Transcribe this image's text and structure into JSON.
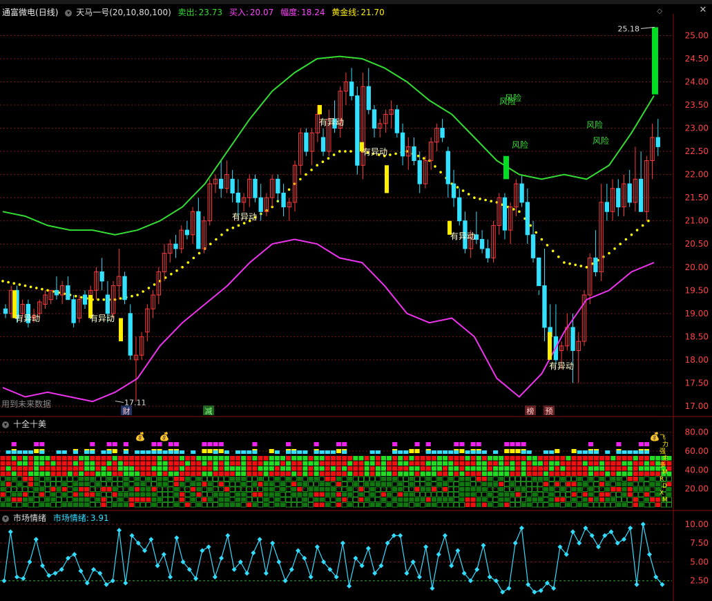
{
  "header": {
    "stock_name": "通富微电",
    "period": "(日线)",
    "indicator_name": "天马一号",
    "indicator_params": "(20,10,80,100)",
    "sell_label": "卖出:",
    "sell_value": "23.73",
    "buy_label": "买入:",
    "buy_value": "20.07",
    "range_label": "幅度:",
    "range_value": "18.24",
    "gold_label": "黄金线:",
    "gold_value": "21.70"
  },
  "panel2": {
    "title": "十全十美"
  },
  "panel3": {
    "title": "市场情绪",
    "label": "市场情绪:",
    "value": "3.91"
  },
  "main_notes": {
    "future_data": "用到未来数据",
    "high_label": "25.18",
    "low_label": "17.11"
  },
  "bottom_tags": [
    {
      "text": "财",
      "x": 183
    },
    {
      "text": "减",
      "x": 302
    },
    {
      "text": "榜",
      "x": 768
    },
    {
      "text": "预",
      "x": 795
    }
  ],
  "annotations": {
    "yidong": "有异动",
    "fengxian": "风险"
  },
  "colors": {
    "up": "#ff3b3b",
    "down": "#33e0ff",
    "upper_band": "#33dd33",
    "lower_band": "#ee33ee",
    "dots": "#ffff00",
    "sell_bar": "#00dd22",
    "buy_bar": "#ffee00",
    "grid": "#7a1a1a"
  },
  "chart_data": [
    {
      "type": "candlestick",
      "title": "天马一号",
      "y_ticks": [
        17.0,
        17.5,
        18.0,
        18.5,
        19.0,
        19.5,
        20.0,
        20.5,
        21.0,
        21.5,
        22.0,
        22.5,
        23.0,
        23.5,
        24.0,
        24.5,
        25.0
      ],
      "ylim": [
        16.85,
        25.35
      ],
      "candles": [
        [
          19.1,
          19.2,
          18.9,
          19.0
        ],
        [
          19.0,
          19.6,
          18.9,
          19.5
        ],
        [
          19.5,
          19.6,
          18.8,
          18.9
        ],
        [
          19.0,
          19.3,
          18.9,
          19.2
        ],
        [
          19.2,
          19.3,
          18.7,
          18.8
        ],
        [
          18.9,
          19.1,
          18.8,
          18.95
        ],
        [
          19.0,
          19.3,
          18.9,
          19.25
        ],
        [
          19.2,
          19.5,
          19.1,
          19.4
        ],
        [
          19.3,
          19.5,
          19.2,
          19.5
        ],
        [
          19.5,
          19.8,
          19.3,
          19.4
        ],
        [
          19.4,
          19.7,
          19.2,
          19.6
        ],
        [
          19.6,
          19.8,
          19.4,
          19.3
        ],
        [
          19.3,
          19.4,
          18.7,
          18.8
        ],
        [
          18.9,
          19.4,
          18.8,
          19.3
        ],
        [
          19.4,
          19.5,
          19.1,
          19.2
        ],
        [
          19.3,
          19.6,
          19.2,
          19.5
        ],
        [
          19.5,
          20.0,
          19.3,
          19.9
        ],
        [
          19.9,
          20.2,
          19.5,
          19.7
        ],
        [
          19.4,
          19.7,
          18.8,
          19.0
        ],
        [
          19.0,
          19.7,
          18.9,
          19.6
        ],
        [
          19.6,
          20.4,
          19.3,
          19.8
        ],
        [
          19.8,
          19.9,
          19.2,
          19.3
        ],
        [
          19.0,
          19.2,
          18.0,
          18.1
        ],
        [
          18.0,
          18.5,
          17.1,
          18.1
        ],
        [
          18.1,
          18.6,
          18.0,
          18.5
        ],
        [
          18.6,
          19.2,
          18.4,
          19.1
        ],
        [
          19.1,
          19.5,
          18.9,
          19.4
        ],
        [
          19.4,
          20.0,
          19.2,
          19.9
        ],
        [
          19.9,
          20.5,
          19.7,
          20.3
        ],
        [
          20.3,
          20.6,
          20.1,
          20.5
        ],
        [
          20.5,
          20.7,
          20.2,
          20.4
        ],
        [
          20.4,
          20.9,
          20.3,
          20.8
        ],
        [
          20.8,
          21.0,
          20.6,
          20.7
        ],
        [
          20.7,
          21.3,
          20.5,
          21.2
        ],
        [
          21.2,
          21.5,
          20.9,
          20.4
        ],
        [
          20.4,
          21.1,
          20.3,
          21.0
        ],
        [
          21.0,
          21.9,
          20.9,
          21.8
        ],
        [
          21.8,
          22.0,
          21.6,
          21.9
        ],
        [
          21.9,
          22.3,
          21.5,
          21.7
        ],
        [
          21.7,
          22.3,
          21.6,
          22.0
        ],
        [
          21.9,
          22.1,
          21.4,
          21.6
        ],
        [
          21.6,
          21.9,
          21.1,
          21.4
        ],
        [
          21.4,
          21.6,
          21.2,
          21.5
        ],
        [
          21.5,
          22.0,
          21.3,
          21.9
        ],
        [
          21.9,
          22.0,
          21.4,
          21.5
        ],
        [
          21.5,
          21.8,
          21.0,
          21.2
        ],
        [
          21.2,
          21.6,
          21.1,
          21.5
        ],
        [
          21.5,
          22.0,
          21.3,
          21.9
        ],
        [
          21.9,
          22.0,
          21.4,
          21.6
        ],
        [
          21.6,
          21.8,
          21.1,
          21.3
        ],
        [
          21.3,
          21.5,
          21.0,
          21.4
        ],
        [
          21.4,
          22.3,
          21.2,
          22.2
        ],
        [
          22.2,
          23.0,
          22.0,
          22.9
        ],
        [
          22.9,
          23.0,
          22.4,
          22.5
        ],
        [
          22.5,
          23.0,
          22.2,
          22.9
        ],
        [
          22.9,
          23.5,
          22.7,
          23.3
        ],
        [
          22.8,
          23.0,
          22.4,
          22.5
        ],
        [
          22.5,
          23.4,
          22.4,
          23.2
        ],
        [
          23.2,
          23.6,
          22.9,
          23.0
        ],
        [
          23.0,
          23.9,
          22.8,
          23.8
        ],
        [
          23.8,
          24.2,
          23.5,
          24.0
        ],
        [
          24.0,
          24.3,
          23.6,
          23.7
        ],
        [
          23.7,
          23.9,
          22.0,
          22.2
        ],
        [
          22.2,
          24.2,
          21.9,
          23.9
        ],
        [
          23.9,
          24.3,
          23.3,
          23.4
        ],
        [
          23.4,
          23.5,
          22.8,
          23.0
        ],
        [
          23.0,
          23.2,
          22.8,
          23.1
        ],
        [
          23.1,
          23.4,
          22.9,
          23.3
        ],
        [
          23.3,
          23.6,
          23.0,
          23.4
        ],
        [
          23.4,
          23.5,
          22.8,
          22.9
        ],
        [
          22.9,
          23.1,
          22.2,
          22.4
        ],
        [
          22.4,
          22.8,
          22.1,
          22.6
        ],
        [
          22.6,
          22.8,
          22.2,
          22.3
        ],
        [
          22.3,
          22.5,
          21.6,
          21.8
        ],
        [
          21.8,
          22.4,
          21.7,
          22.3
        ],
        [
          22.3,
          22.8,
          22.1,
          22.7
        ],
        [
          22.7,
          23.1,
          22.5,
          23.0
        ],
        [
          23.0,
          23.2,
          22.7,
          22.8
        ],
        [
          22.5,
          22.6,
          21.5,
          21.8
        ],
        [
          21.8,
          22.1,
          21.3,
          21.5
        ],
        [
          21.5,
          21.7,
          20.9,
          21.0
        ],
        [
          21.0,
          21.2,
          20.3,
          20.4
        ],
        [
          20.4,
          20.8,
          20.2,
          20.7
        ],
        [
          20.7,
          21.2,
          20.5,
          20.6
        ],
        [
          20.6,
          20.8,
          20.3,
          20.4
        ],
        [
          20.4,
          20.6,
          20.1,
          20.2
        ],
        [
          20.2,
          21.0,
          20.1,
          20.9
        ],
        [
          20.9,
          21.6,
          20.7,
          21.5
        ],
        [
          21.5,
          21.6,
          20.6,
          20.8
        ],
        [
          20.8,
          21.4,
          20.5,
          21.3
        ],
        [
          21.3,
          21.9,
          21.1,
          21.8
        ],
        [
          21.8,
          22.0,
          21.3,
          21.4
        ],
        [
          21.4,
          21.7,
          20.5,
          20.7
        ],
        [
          20.7,
          21.0,
          20.1,
          20.2
        ],
        [
          20.2,
          19.5,
          19.4,
          19.6
        ],
        [
          19.6,
          20.4,
          18.4,
          18.7
        ],
        [
          18.7,
          19.2,
          18.3,
          18.5
        ],
        [
          18.5,
          19.2,
          17.9,
          18.0
        ],
        [
          18.2,
          18.4,
          17.8,
          18.3
        ],
        [
          18.3,
          19.0,
          18.2,
          18.7
        ],
        [
          18.7,
          19.0,
          17.5,
          18.2
        ],
        [
          18.2,
          18.6,
          17.5,
          18.4
        ],
        [
          18.4,
          19.5,
          18.3,
          19.4
        ],
        [
          19.4,
          20.3,
          19.2,
          20.2
        ],
        [
          20.2,
          20.8,
          19.8,
          19.9
        ],
        [
          19.9,
          21.8,
          19.7,
          21.4
        ],
        [
          21.4,
          21.8,
          21.0,
          21.2
        ],
        [
          21.2,
          21.9,
          21.0,
          21.7
        ],
        [
          21.7,
          21.9,
          21.1,
          21.3
        ],
        [
          21.3,
          22.0,
          21.1,
          21.8
        ],
        [
          21.8,
          22.1,
          21.3,
          21.4
        ],
        [
          21.4,
          22.6,
          21.2,
          21.9
        ],
        [
          21.9,
          22.5,
          21.6,
          21.2
        ],
        [
          21.2,
          22.4,
          21.0,
          22.3
        ],
        [
          22.3,
          23.1,
          21.9,
          22.8
        ],
        [
          22.8,
          23.2,
          22.4,
          22.6
        ]
      ],
      "upper_band": [
        21.2,
        21.1,
        20.9,
        20.8,
        20.8,
        20.7,
        20.8,
        21.0,
        21.3,
        21.8,
        22.5,
        23.2,
        23.8,
        24.2,
        24.5,
        24.55,
        24.5,
        24.3,
        24.0,
        23.6,
        23.3,
        22.8,
        22.3,
        22.0,
        21.9,
        22.0,
        21.9,
        22.2,
        22.9,
        23.7
      ],
      "lower_band": [
        17.4,
        17.2,
        17.3,
        17.2,
        17.1,
        17.3,
        17.6,
        18.3,
        18.8,
        19.2,
        19.6,
        20.1,
        20.5,
        20.6,
        20.5,
        20.2,
        20.1,
        19.6,
        19.0,
        18.8,
        18.9,
        18.5,
        17.6,
        17.2,
        17.7,
        18.6,
        19.3,
        19.5,
        19.9,
        20.1
      ],
      "dot_line": [
        19.7,
        19.6,
        19.5,
        19.4,
        19.3,
        19.3,
        19.4,
        19.7,
        20.0,
        20.4,
        20.8,
        21.0,
        21.3,
        21.8,
        22.2,
        22.5,
        22.5,
        22.4,
        22.5,
        22.3,
        21.8,
        21.5,
        21.4,
        21.2,
        20.6,
        20.1,
        20.0,
        20.3,
        20.7,
        21.1
      ],
      "sell_bar": {
        "low": 23.73,
        "high": 25.18
      },
      "high_point": 25.18,
      "low_point": 17.11
    },
    {
      "type": "heatmap",
      "title": "十全十美",
      "y_ticks": [
        20.0,
        40.0,
        60.0,
        80.0
      ],
      "ylim": [
        0,
        90
      ],
      "right_labels": [
        "飞",
        "力",
        "强",
        "主",
        "多",
        "M",
        "R",
        "D",
        "X",
        "M"
      ]
    },
    {
      "type": "line",
      "title": "市场情绪",
      "y_ticks": [
        2.5,
        5.0,
        7.5,
        10.0
      ],
      "ylim": [
        0,
        11
      ],
      "values": [
        2.5,
        9.0,
        3.0,
        2.8,
        5.0,
        8.0,
        4.5,
        3.2,
        3.5,
        4.0,
        5.5,
        6.0,
        3.8,
        2.2,
        4.0,
        3.5,
        2.0,
        2.5,
        9.2,
        2.2,
        8.5,
        7.5,
        6.5,
        8.0,
        4.5,
        6.0,
        3.0,
        8.2,
        5.0,
        4.0,
        2.8,
        6.5,
        7.0,
        3.0,
        5.5,
        8.5,
        4.0,
        5.0,
        3.5,
        6.2,
        8.0,
        3.5,
        7.5,
        5.0,
        2.5,
        4.0,
        6.5,
        5.5,
        3.0,
        7.0,
        5.0,
        4.0,
        3.0,
        7.5,
        1.8,
        5.5,
        4.5,
        6.8,
        3.5,
        4.5,
        7.5,
        8.5,
        8.5,
        3.5,
        5.0,
        3.0,
        7.0,
        1.5,
        6.0,
        8.5,
        4.5,
        6.5,
        3.5,
        2.5,
        4.0,
        7.2,
        3.0,
        2.5,
        1.0,
        1.5,
        7.5,
        9.5,
        2.0,
        1.0,
        1.2,
        2.2,
        1.5,
        7.0,
        6.0,
        9.0,
        7.5,
        9.5,
        8.5,
        7.0,
        8.5,
        9.0,
        7.5,
        8.0,
        9.5,
        2.0,
        10.0,
        6.0,
        3.0,
        2.0
      ]
    }
  ]
}
